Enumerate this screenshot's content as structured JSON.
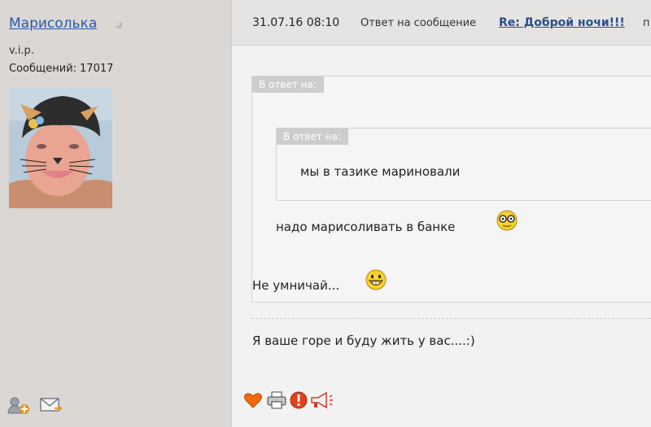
{
  "user": {
    "name": "Марисолька",
    "rank": "v.i.p.",
    "posts_label": "Сообщений:",
    "posts_count": "17017"
  },
  "post": {
    "date": "31.07.16 08:10",
    "reply_prefix": "Ответ на сообщение",
    "thread_link": "Re: Доброй ночи!!!",
    "header_trailing": "п"
  },
  "quote_outer": {
    "label": "В ответ на:",
    "text": "надо марисоливать в банке"
  },
  "quote_inner": {
    "label": "В ответ на:",
    "text": "мы в тазике мариновали"
  },
  "message": {
    "line1": "Не умничай...",
    "line2": "Я ваше горе и буду жить у вас....:)"
  },
  "icons": {
    "user_actions": [
      "add-friend-icon",
      "private-message-icon"
    ],
    "post_actions": [
      "heart-icon",
      "print-icon",
      "report-icon",
      "megaphone-icon"
    ]
  },
  "colors": {
    "link": "#2b5aa6",
    "sidebar_bg": "#dad7d5",
    "quote_label_bg": "#cdcdcd"
  }
}
